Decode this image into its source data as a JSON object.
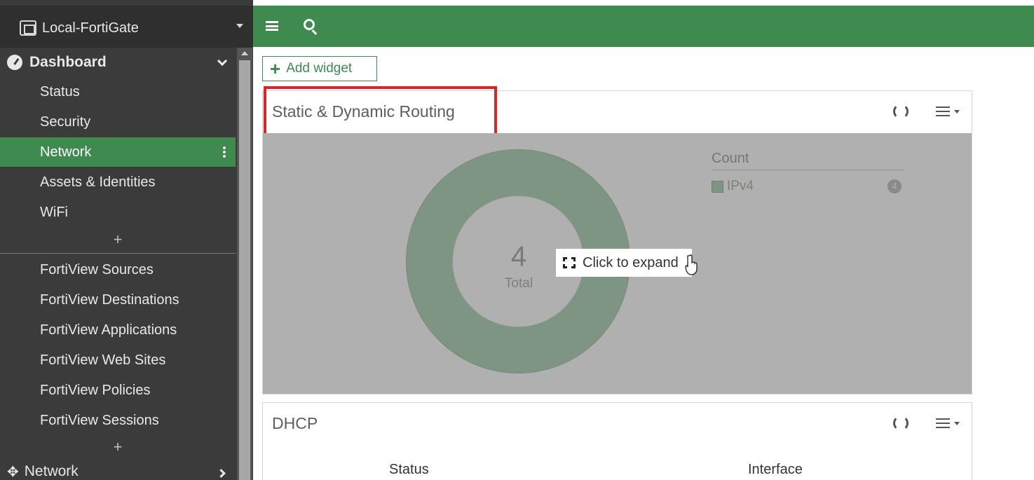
{
  "sidebar": {
    "device_name": "Local-FortiGate",
    "dashboard": {
      "label": "Dashboard",
      "items": [
        "Status",
        "Security",
        "Network",
        "Assets & Identities",
        "WiFi"
      ],
      "active_item": "Network"
    },
    "fortiview_items": [
      "FortiView Sources",
      "FortiView Destinations",
      "FortiView Applications",
      "FortiView Web Sites",
      "FortiView Policies",
      "FortiView Sessions"
    ],
    "add_symbol": "+",
    "network_section": {
      "label": "Network"
    }
  },
  "topbar": {
    "icons": [
      "menu-icon",
      "search-icon"
    ],
    "accent": "#3f8b4f"
  },
  "toolbar": {
    "add_widget_label": "Add widget",
    "add_widget_symbol": "+"
  },
  "routing_widget": {
    "title": "Static & Dynamic Routing",
    "donut_total_value": "4",
    "donut_total_label": "Total",
    "legend_header": "Count",
    "legend": [
      {
        "label": "IPv4",
        "count": "4"
      }
    ],
    "expand_tooltip": "Click to expand",
    "highlight_color": "#e02424"
  },
  "dhcp_widget": {
    "title": "DHCP",
    "columns": [
      "Status",
      "Interface"
    ]
  }
}
